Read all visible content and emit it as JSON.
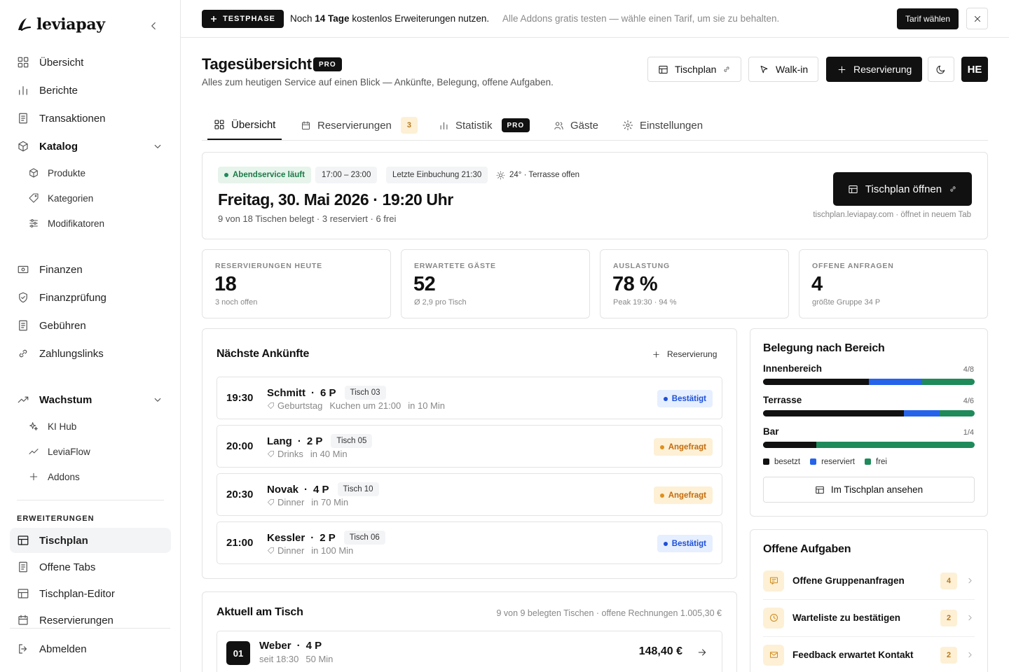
{
  "app": {
    "brand": "leviapay"
  },
  "sidebar": {
    "items": [
      {
        "label": "Übersicht"
      },
      {
        "label": "Berichte"
      },
      {
        "label": "Transaktionen"
      },
      {
        "label": "Katalog"
      },
      {
        "label": "Finanzen"
      },
      {
        "label": "Finanzprüfung"
      },
      {
        "label": "Gebühren"
      },
      {
        "label": "Zahlungslinks"
      },
      {
        "label": "Wachstum"
      }
    ],
    "katalog_sub": [
      {
        "label": "Produkte"
      },
      {
        "label": "Kategorien"
      },
      {
        "label": "Modifikatoren"
      }
    ],
    "wachstum_sub": [
      {
        "label": "KI Hub"
      },
      {
        "label": "LeviaFlow"
      },
      {
        "label": "Addons"
      }
    ],
    "section_label": "ERWEITERUNGEN",
    "ext_items": [
      {
        "label": "Tischplan"
      },
      {
        "label": "Offene Tabs"
      },
      {
        "label": "Tischplan-Editor"
      },
      {
        "label": "Reservierungen"
      }
    ],
    "logout": "Abmelden"
  },
  "banner": {
    "badge": "TESTPHASE",
    "main_pre": "Noch ",
    "main_bold": "14 Tage",
    "main_post": " kostenlos Erweiterungen nutzen.",
    "sub": "Alle Addons gratis testen — wähle einen Tarif, um sie zu behalten.",
    "cta": "Tarif wählen"
  },
  "header": {
    "title": "Tagesübersicht",
    "badge": "PRO",
    "subtitle": "Alles zum heutigen Service auf einen Blick — Ankünfte, Belegung, offene Aufgaben.",
    "btn_tischplan": "Tischplan",
    "btn_walkin": "Walk-in",
    "btn_reservierung": "Reservierung",
    "avatar": "HE"
  },
  "tabs": [
    {
      "label": "Übersicht"
    },
    {
      "label": "Reservierungen",
      "count": "3"
    },
    {
      "label": "Statistik",
      "badge": "PRO"
    },
    {
      "label": "Gäste"
    },
    {
      "label": "Einstellungen"
    }
  ],
  "service": {
    "status": "Abendservice läuft",
    "hours": "17:00 – 23:00",
    "last_booking": "Letzte Einbuchung 21:30",
    "weather": "24° · Terrasse offen",
    "datetime": "Freitag, 30. Mai 2026 · 19:20 Uhr",
    "summary": "9 von 18 Tischen belegt · 3 reserviert · 6 frei",
    "open_button": "Tischplan öffnen",
    "url_note": "tischplan.leviapay.com · öffnet in neuem Tab"
  },
  "kpis": [
    {
      "label": "RESERVIERUNGEN HEUTE",
      "value": "18",
      "sub": "3 noch offen"
    },
    {
      "label": "ERWARTETE GÄSTE",
      "value": "52",
      "sub": "Ø 2,9 pro Tisch"
    },
    {
      "label": "AUSLASTUNG",
      "value": "78 %",
      "sub": "Peak 19:30 · 94 %"
    },
    {
      "label": "OFFENE ANFRAGEN",
      "value": "4",
      "sub": "größte Gruppe 34 P"
    }
  ],
  "arrivals": {
    "title": "Nächste Ankünfte",
    "action": "Reservierung",
    "rows": [
      {
        "time": "19:30",
        "name": "Schmitt",
        "persons": "6 P",
        "table": "Tisch  03",
        "tag": "Geburtstag",
        "note": "Kuchen um 21:00",
        "eta": "in 10 Min",
        "status": "Bestätigt",
        "status_color": "#1e4fd8"
      },
      {
        "time": "20:00",
        "name": "Lang",
        "persons": "2 P",
        "table": "Tisch  05",
        "tag": "Drinks",
        "note": "",
        "eta": "in 40 Min",
        "status": "Angefragt",
        "status_color": "#e0901c"
      },
      {
        "time": "20:30",
        "name": "Novak",
        "persons": "4 P",
        "table": "Tisch  10",
        "tag": "Dinner",
        "note": "",
        "eta": "in 70 Min",
        "status": "Angefragt",
        "status_color": "#e0901c"
      },
      {
        "time": "21:00",
        "name": "Kessler",
        "persons": "2 P",
        "table": "Tisch  06",
        "tag": "Dinner",
        "note": "",
        "eta": "in 100 Min",
        "status": "Bestätigt",
        "status_color": "#1e4fd8"
      }
    ]
  },
  "current": {
    "title": "Aktuell am Tisch",
    "summary": "9 von 9 belegten Tischen · offene Rechnungen 1.005,30 €",
    "rows": [
      {
        "table": "01",
        "name": "Weber",
        "persons": "4 P",
        "since": "seit 18:30",
        "duration": "50 Min",
        "amount": "148,40 €"
      }
    ]
  },
  "occupancy": {
    "title": "Belegung nach Bereich",
    "areas": [
      {
        "name": "Innenbereich",
        "count": "4/8",
        "besetzt": 0.5,
        "reserviert": 0.25
      },
      {
        "name": "Terrasse",
        "count": "4/6",
        "besetzt": 0.667,
        "reserviert": 0.167
      },
      {
        "name": "Bar",
        "count": "1/4",
        "besetzt": 0.25,
        "reserviert": 0
      }
    ],
    "legend": [
      "besetzt",
      "reserviert",
      "frei"
    ],
    "colors": {
      "besetzt": "#111111",
      "reserviert": "#2563eb",
      "frei": "#1f8a5a"
    },
    "button": "Im Tischplan ansehen"
  },
  "tasks": {
    "title": "Offene Aufgaben",
    "items": [
      {
        "label": "Offene Gruppenanfragen",
        "count": "4",
        "icon": "message-icon"
      },
      {
        "label": "Warteliste zu bestätigen",
        "count": "2",
        "icon": "clock-icon"
      },
      {
        "label": "Feedback erwartet Kontakt",
        "count": "2",
        "icon": "mail-icon"
      }
    ]
  }
}
